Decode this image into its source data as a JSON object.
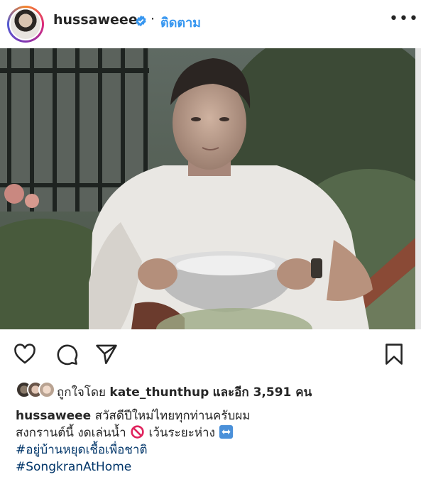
{
  "post": {
    "username": "hussaweee",
    "follow_label": "ติดตาม",
    "dot": "·",
    "more_glyph": "•••"
  },
  "likes": {
    "prefix": "ถูกใจโดย",
    "liker": "kate_thunthup",
    "suffix": "และอีก 3,591 คน"
  },
  "caption": {
    "username": "hussaweee",
    "line1": "สวัสดีปีใหม่ไทยทุกท่านครับผม",
    "line2_text": "สงกรานต์นี้ งดเล่นน้ำ",
    "line2_mid": "เว้นระยะห่าง",
    "hashtag1": "#อยู่บ้านหยุดเชื้อเพื่อชาติ",
    "hashtag2": "#SongkranAtHome"
  },
  "colors": {
    "link_blue": "#3897f0",
    "hashtag": "#003569",
    "text": "#262626"
  },
  "icons": [
    "verified-badge-icon",
    "more-options-icon",
    "heart-icon",
    "comment-icon",
    "share-icon",
    "bookmark-icon",
    "prohibited-icon",
    "left-right-arrow-icon"
  ]
}
